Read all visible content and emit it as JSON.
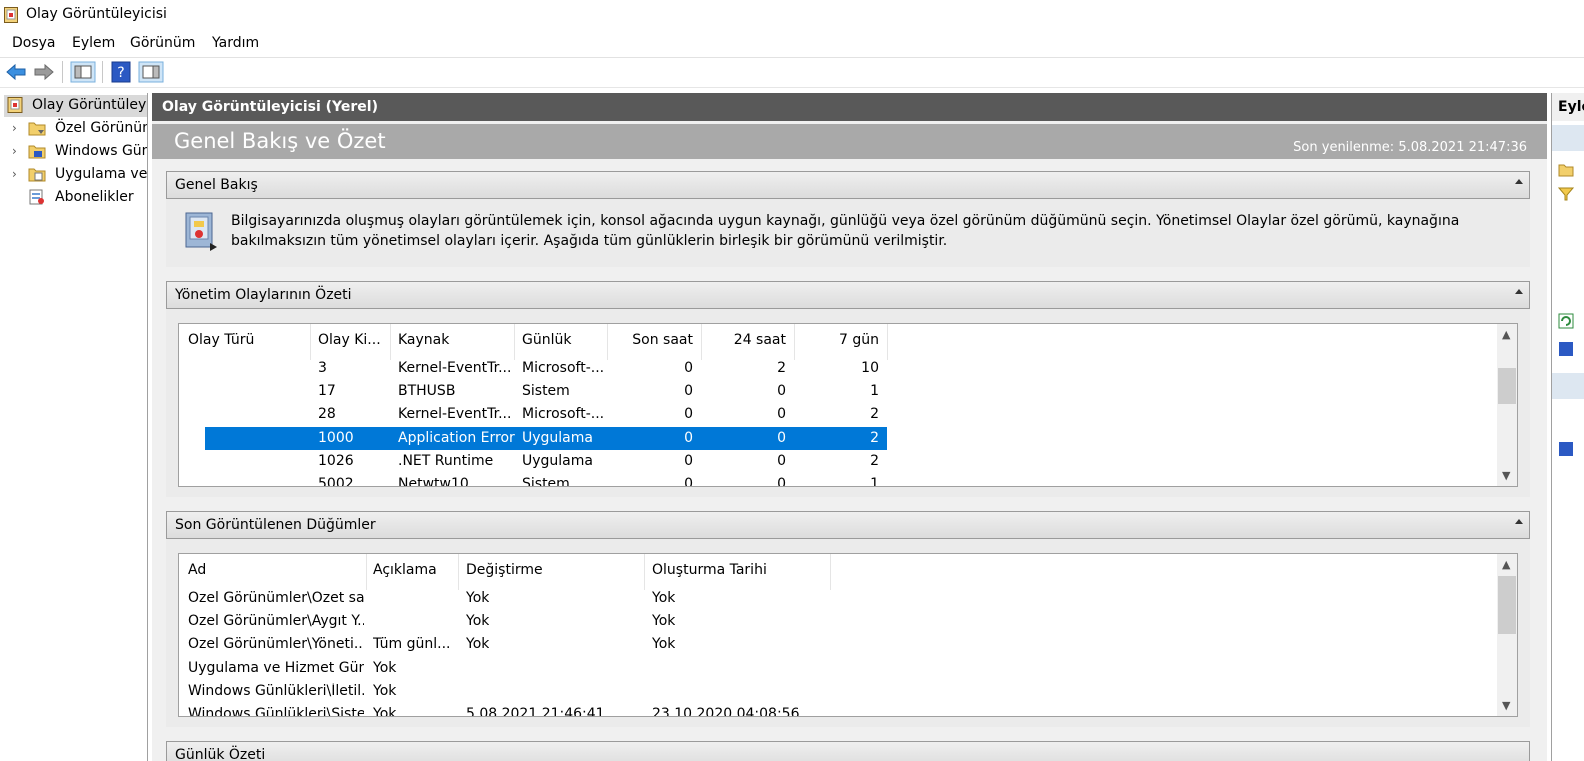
{
  "window": {
    "title": "Olay Görüntüleyicisi"
  },
  "menu": [
    "Dosya",
    "Eylem",
    "Görünüm",
    "Yardım"
  ],
  "tree": [
    {
      "label": "Olay Görüntüleyicisi (Yerel)",
      "expandable": false,
      "selected": true
    },
    {
      "label": "Özel Görünümler",
      "expandable": true
    },
    {
      "label": "Windows Günlükleri",
      "expandable": true
    },
    {
      "label": "Uygulama ve Hizmet Günlükleri",
      "expandable": true
    },
    {
      "label": "Abonelikler",
      "expandable": false
    }
  ],
  "center": {
    "header": "Olay Görüntüleyicisi (Yerel)",
    "big_title": "Genel Bakış ve Özet",
    "refresh": "Son yenilenme: 5.08.2021 21:47:36"
  },
  "overview": {
    "title": "Genel Bakış",
    "text": "Bilgisayarınızda oluşmuş olayları görüntülemek için, konsol ağacında uygun kaynağı, günlüğü veya özel görünüm düğümünü seçin. Yönetimsel Olaylar özel görümü, kaynağına bakılmaksızın tüm yönetimsel olayları içerir. Aşağıda tüm günlüklerin birleşik bir görümünü verilmiştir."
  },
  "admin_summary": {
    "title": "Yönetim Olaylarının Özeti",
    "columns": [
      "Olay Türü",
      "Olay Ki...",
      "Kaynak",
      "Günlük",
      "Son saat",
      "24 saat",
      "7 gün"
    ],
    "rows": [
      {
        "id": "3",
        "source": "Kernel-EventTr...",
        "log": "Microsoft-...",
        "hour": "0",
        "day": "2",
        "week": "10"
      },
      {
        "id": "17",
        "source": "BTHUSB",
        "log": "Sistem",
        "hour": "0",
        "day": "0",
        "week": "1"
      },
      {
        "id": "28",
        "source": "Kernel-EventTr...",
        "log": "Microsoft-...",
        "hour": "0",
        "day": "0",
        "week": "2"
      },
      {
        "id": "1000",
        "source": "Application Error",
        "log": "Uygulama",
        "hour": "0",
        "day": "0",
        "week": "2",
        "selected": true
      },
      {
        "id": "1026",
        "source": ".NET Runtime",
        "log": "Uygulama",
        "hour": "0",
        "day": "0",
        "week": "2"
      },
      {
        "id": "5002",
        "source": "Netwtw10",
        "log": "Sistem",
        "hour": "0",
        "day": "0",
        "week": "1"
      }
    ]
  },
  "recent_nodes": {
    "title": "Son Görüntülenen Düğümler",
    "columns": [
      "Ad",
      "Açıklama",
      "Değiştirme",
      "Oluşturma Tarihi"
    ],
    "rows": [
      {
        "name": "Özel Görünümler\\Özet sa...",
        "desc": "",
        "modified": "Yok",
        "created": "Yok"
      },
      {
        "name": "Özel Görünümler\\Aygıt Y...",
        "desc": "",
        "modified": "Yok",
        "created": "Yok"
      },
      {
        "name": "Özel Görünümler\\Yöneti...",
        "desc": "Tüm günl...",
        "modified": "Yok",
        "created": "Yok"
      },
      {
        "name": "Uygulama ve Hizmet Gün...",
        "desc": "Yok",
        "modified": "",
        "created": ""
      },
      {
        "name": "Windows Günlükleri\\İletil...",
        "desc": "Yok",
        "modified": "",
        "created": ""
      },
      {
        "name": "Windows Günlükleri\\Siste...",
        "desc": "Yok",
        "modified": "5.08.2021 21:46:41",
        "created": "23.10.2020 04:08:56"
      }
    ]
  },
  "log_summary": {
    "title": "Günlük Özeti"
  },
  "actions": {
    "title": "Eylemler"
  }
}
